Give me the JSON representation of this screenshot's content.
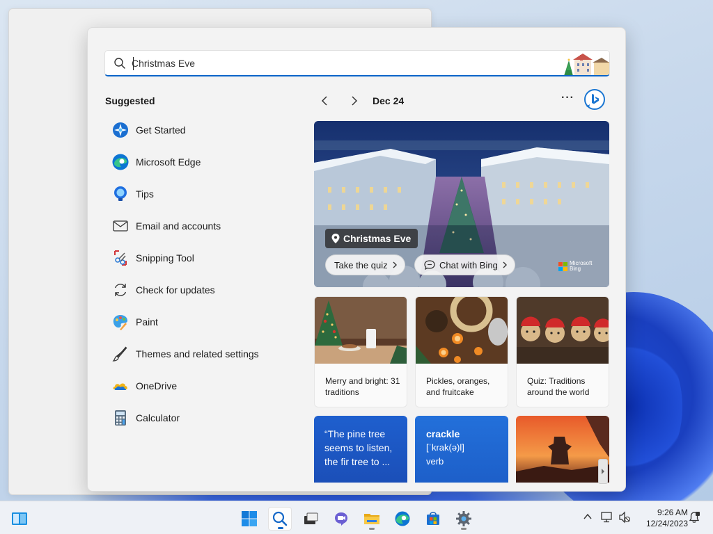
{
  "search": {
    "value": "Christmas Eve",
    "placeholder": "",
    "icon": "search-icon"
  },
  "suggested": {
    "title": "Suggested",
    "items": [
      {
        "label": "Get Started",
        "icon": "get-started-icon"
      },
      {
        "label": "Microsoft Edge",
        "icon": "edge-icon"
      },
      {
        "label": "Tips",
        "icon": "tips-icon"
      },
      {
        "label": "Email and accounts",
        "icon": "mail-icon"
      },
      {
        "label": "Snipping Tool",
        "icon": "snipping-tool-icon"
      },
      {
        "label": "Check for updates",
        "icon": "refresh-icon"
      },
      {
        "label": "Paint",
        "icon": "paint-icon"
      },
      {
        "label": "Themes and related settings",
        "icon": "brush-icon"
      },
      {
        "label": "OneDrive",
        "icon": "onedrive-icon"
      },
      {
        "label": "Calculator",
        "icon": "calculator-icon"
      }
    ]
  },
  "highlights": {
    "date": "Dec 24",
    "more": "···",
    "hero": {
      "title": "Christmas Eve",
      "quiz_button": "Take the quiz",
      "chat_button": "Chat with Bing",
      "brand_line1": "Microsoft",
      "brand_line2": "Bing"
    },
    "cards": [
      {
        "caption": "Merry and bright: 31 traditions"
      },
      {
        "caption": "Pickles, oranges, and fruitcake"
      },
      {
        "caption": "Quiz: Traditions around the world"
      }
    ],
    "quote_tile": "“The pine tree seems to listen, the fir tree to ...",
    "word_tile": {
      "word": "crackle",
      "pronunciation": "[ˈkrak(ə)l]",
      "part_of_speech": "verb"
    }
  },
  "taskbar": {
    "time": "9:26 AM",
    "date": "12/24/2023",
    "apps": [
      "windows-start-icon",
      "search-icon",
      "task-view-icon",
      "chat-icon",
      "file-explorer-icon",
      "edge-icon",
      "store-icon",
      "settings-icon"
    ]
  },
  "colors": {
    "accent": "#0a64c9",
    "panel_bg": "#f3f3f3",
    "tile_blue": "#1e5fce"
  }
}
